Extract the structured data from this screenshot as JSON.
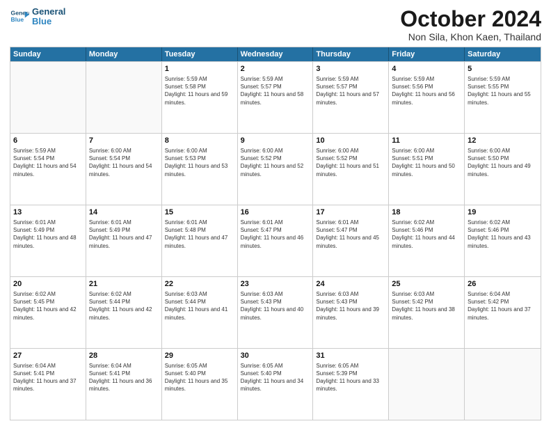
{
  "logo": {
    "line1": "General",
    "line2": "Blue"
  },
  "title": "October 2024",
  "subtitle": "Non Sila, Khon Kaen, Thailand",
  "headers": [
    "Sunday",
    "Monday",
    "Tuesday",
    "Wednesday",
    "Thursday",
    "Friday",
    "Saturday"
  ],
  "weeks": [
    [
      {
        "day": "",
        "sunrise": "",
        "sunset": "",
        "daylight": "",
        "empty": true
      },
      {
        "day": "",
        "sunrise": "",
        "sunset": "",
        "daylight": "",
        "empty": true
      },
      {
        "day": "1",
        "sunrise": "Sunrise: 5:59 AM",
        "sunset": "Sunset: 5:58 PM",
        "daylight": "Daylight: 11 hours and 59 minutes."
      },
      {
        "day": "2",
        "sunrise": "Sunrise: 5:59 AM",
        "sunset": "Sunset: 5:57 PM",
        "daylight": "Daylight: 11 hours and 58 minutes."
      },
      {
        "day": "3",
        "sunrise": "Sunrise: 5:59 AM",
        "sunset": "Sunset: 5:57 PM",
        "daylight": "Daylight: 11 hours and 57 minutes."
      },
      {
        "day": "4",
        "sunrise": "Sunrise: 5:59 AM",
        "sunset": "Sunset: 5:56 PM",
        "daylight": "Daylight: 11 hours and 56 minutes."
      },
      {
        "day": "5",
        "sunrise": "Sunrise: 5:59 AM",
        "sunset": "Sunset: 5:55 PM",
        "daylight": "Daylight: 11 hours and 55 minutes."
      }
    ],
    [
      {
        "day": "6",
        "sunrise": "Sunrise: 5:59 AM",
        "sunset": "Sunset: 5:54 PM",
        "daylight": "Daylight: 11 hours and 54 minutes."
      },
      {
        "day": "7",
        "sunrise": "Sunrise: 6:00 AM",
        "sunset": "Sunset: 5:54 PM",
        "daylight": "Daylight: 11 hours and 54 minutes."
      },
      {
        "day": "8",
        "sunrise": "Sunrise: 6:00 AM",
        "sunset": "Sunset: 5:53 PM",
        "daylight": "Daylight: 11 hours and 53 minutes."
      },
      {
        "day": "9",
        "sunrise": "Sunrise: 6:00 AM",
        "sunset": "Sunset: 5:52 PM",
        "daylight": "Daylight: 11 hours and 52 minutes."
      },
      {
        "day": "10",
        "sunrise": "Sunrise: 6:00 AM",
        "sunset": "Sunset: 5:52 PM",
        "daylight": "Daylight: 11 hours and 51 minutes."
      },
      {
        "day": "11",
        "sunrise": "Sunrise: 6:00 AM",
        "sunset": "Sunset: 5:51 PM",
        "daylight": "Daylight: 11 hours and 50 minutes."
      },
      {
        "day": "12",
        "sunrise": "Sunrise: 6:00 AM",
        "sunset": "Sunset: 5:50 PM",
        "daylight": "Daylight: 11 hours and 49 minutes."
      }
    ],
    [
      {
        "day": "13",
        "sunrise": "Sunrise: 6:01 AM",
        "sunset": "Sunset: 5:49 PM",
        "daylight": "Daylight: 11 hours and 48 minutes."
      },
      {
        "day": "14",
        "sunrise": "Sunrise: 6:01 AM",
        "sunset": "Sunset: 5:49 PM",
        "daylight": "Daylight: 11 hours and 47 minutes."
      },
      {
        "day": "15",
        "sunrise": "Sunrise: 6:01 AM",
        "sunset": "Sunset: 5:48 PM",
        "daylight": "Daylight: 11 hours and 47 minutes."
      },
      {
        "day": "16",
        "sunrise": "Sunrise: 6:01 AM",
        "sunset": "Sunset: 5:47 PM",
        "daylight": "Daylight: 11 hours and 46 minutes."
      },
      {
        "day": "17",
        "sunrise": "Sunrise: 6:01 AM",
        "sunset": "Sunset: 5:47 PM",
        "daylight": "Daylight: 11 hours and 45 minutes."
      },
      {
        "day": "18",
        "sunrise": "Sunrise: 6:02 AM",
        "sunset": "Sunset: 5:46 PM",
        "daylight": "Daylight: 11 hours and 44 minutes."
      },
      {
        "day": "19",
        "sunrise": "Sunrise: 6:02 AM",
        "sunset": "Sunset: 5:46 PM",
        "daylight": "Daylight: 11 hours and 43 minutes."
      }
    ],
    [
      {
        "day": "20",
        "sunrise": "Sunrise: 6:02 AM",
        "sunset": "Sunset: 5:45 PM",
        "daylight": "Daylight: 11 hours and 42 minutes."
      },
      {
        "day": "21",
        "sunrise": "Sunrise: 6:02 AM",
        "sunset": "Sunset: 5:44 PM",
        "daylight": "Daylight: 11 hours and 42 minutes."
      },
      {
        "day": "22",
        "sunrise": "Sunrise: 6:03 AM",
        "sunset": "Sunset: 5:44 PM",
        "daylight": "Daylight: 11 hours and 41 minutes."
      },
      {
        "day": "23",
        "sunrise": "Sunrise: 6:03 AM",
        "sunset": "Sunset: 5:43 PM",
        "daylight": "Daylight: 11 hours and 40 minutes."
      },
      {
        "day": "24",
        "sunrise": "Sunrise: 6:03 AM",
        "sunset": "Sunset: 5:43 PM",
        "daylight": "Daylight: 11 hours and 39 minutes."
      },
      {
        "day": "25",
        "sunrise": "Sunrise: 6:03 AM",
        "sunset": "Sunset: 5:42 PM",
        "daylight": "Daylight: 11 hours and 38 minutes."
      },
      {
        "day": "26",
        "sunrise": "Sunrise: 6:04 AM",
        "sunset": "Sunset: 5:42 PM",
        "daylight": "Daylight: 11 hours and 37 minutes."
      }
    ],
    [
      {
        "day": "27",
        "sunrise": "Sunrise: 6:04 AM",
        "sunset": "Sunset: 5:41 PM",
        "daylight": "Daylight: 11 hours and 37 minutes."
      },
      {
        "day": "28",
        "sunrise": "Sunrise: 6:04 AM",
        "sunset": "Sunset: 5:41 PM",
        "daylight": "Daylight: 11 hours and 36 minutes."
      },
      {
        "day": "29",
        "sunrise": "Sunrise: 6:05 AM",
        "sunset": "Sunset: 5:40 PM",
        "daylight": "Daylight: 11 hours and 35 minutes."
      },
      {
        "day": "30",
        "sunrise": "Sunrise: 6:05 AM",
        "sunset": "Sunset: 5:40 PM",
        "daylight": "Daylight: 11 hours and 34 minutes."
      },
      {
        "day": "31",
        "sunrise": "Sunrise: 6:05 AM",
        "sunset": "Sunset: 5:39 PM",
        "daylight": "Daylight: 11 hours and 33 minutes."
      },
      {
        "day": "",
        "sunrise": "",
        "sunset": "",
        "daylight": "",
        "empty": true
      },
      {
        "day": "",
        "sunrise": "",
        "sunset": "",
        "daylight": "",
        "empty": true
      }
    ]
  ]
}
